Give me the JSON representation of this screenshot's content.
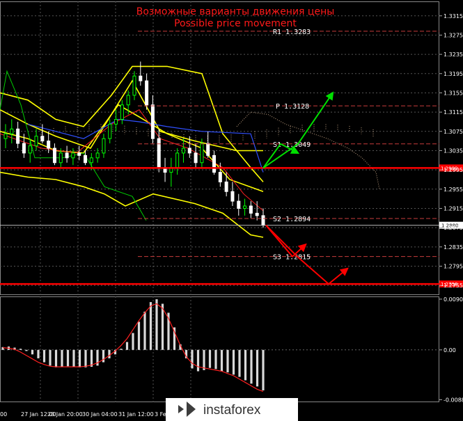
{
  "chart_data": {
    "type": "candlestick",
    "title": "Возможные варианты движения цены",
    "subtitle": "Possible price movement",
    "price_axis": {
      "ticks": [
        1.3315,
        1.3275,
        1.3235,
        1.3195,
        1.3155,
        1.3115,
        1.3075,
        1.3035,
        1.2995,
        1.2955,
        1.2915,
        1.2875,
        1.2835,
        1.2795,
        1.2755
      ],
      "labels": [
        "1.3315",
        "1.3275",
        "1.3235",
        "1.3195",
        "1.3155",
        "1.3115",
        "1.3075",
        "1.3035",
        "1.2995",
        "1.2955",
        "1.2915",
        "1.2875",
        "1.2835",
        "1.2795",
        "1.2755"
      ],
      "range": [
        1.2735,
        1.3345
      ]
    },
    "time_axis": {
      "labels": [
        "00",
        "27 Jan 12:00",
        "28 Jan 20:00",
        "30 Jan 04:00",
        "31 Jan 12:00",
        "3 Feb"
      ]
    },
    "levels": [
      {
        "name": "R1",
        "text": "R1  1.3283",
        "value": 1.3283,
        "color": "#c83c3c"
      },
      {
        "name": "P",
        "text": "P  1.3128",
        "value": 1.3128,
        "color": "#c83c3c"
      },
      {
        "name": "S1",
        "text": "S1  1.3049",
        "value": 1.3049,
        "color": "#c83c3c"
      },
      {
        "name": "S2",
        "text": "S2  1.2894",
        "value": 1.2894,
        "color": "#c83c3c"
      },
      {
        "name": "S3",
        "text": "S3  1.2815",
        "value": 1.2815,
        "color": "#c83c3c"
      }
    ],
    "support_resistance": [
      {
        "value": 1.2999,
        "label": "1.2999",
        "color": "#ff0000"
      },
      {
        "value": 1.2758,
        "label": "1.2758",
        "color": "#ff0000"
      }
    ],
    "current_price": {
      "value": 1.288,
      "label": "1.2880"
    },
    "candles": [
      [
        1.306,
        1.309,
        1.304,
        1.307
      ],
      [
        1.307,
        1.31,
        1.305,
        1.308
      ],
      [
        1.308,
        1.3095,
        1.304,
        1.305
      ],
      [
        1.305,
        1.307,
        1.302,
        1.303
      ],
      [
        1.303,
        1.306,
        1.301,
        1.3045
      ],
      [
        1.3045,
        1.308,
        1.3035,
        1.3065
      ],
      [
        1.3065,
        1.309,
        1.305,
        1.3055
      ],
      [
        1.3055,
        1.3075,
        1.303,
        1.304
      ],
      [
        1.304,
        1.305,
        1.3005,
        1.301
      ],
      [
        1.301,
        1.304,
        1.3,
        1.303
      ],
      [
        1.303,
        1.3045,
        1.301,
        1.302
      ],
      [
        1.302,
        1.304,
        1.3005,
        1.303
      ],
      [
        1.303,
        1.3045,
        1.3015,
        1.3025
      ],
      [
        1.3025,
        1.3035,
        1.3005,
        1.301
      ],
      [
        1.301,
        1.303,
        1.2995,
        1.302
      ],
      [
        1.302,
        1.304,
        1.301,
        1.303
      ],
      [
        1.303,
        1.307,
        1.302,
        1.306
      ],
      [
        1.306,
        1.31,
        1.305,
        1.309
      ],
      [
        1.309,
        1.312,
        1.3075,
        1.31
      ],
      [
        1.31,
        1.314,
        1.309,
        1.313
      ],
      [
        1.313,
        1.316,
        1.311,
        1.315
      ],
      [
        1.315,
        1.32,
        1.314,
        1.319
      ],
      [
        1.319,
        1.322,
        1.317,
        1.318
      ],
      [
        1.318,
        1.3195,
        1.312,
        1.313
      ],
      [
        1.313,
        1.315,
        1.305,
        1.306
      ],
      [
        1.306,
        1.308,
        1.299,
        1.3
      ],
      [
        1.3,
        1.302,
        1.297,
        1.299
      ],
      [
        1.299,
        1.302,
        1.296,
        1.3
      ],
      [
        1.3,
        1.304,
        1.2985,
        1.303
      ],
      [
        1.303,
        1.306,
        1.301,
        1.304
      ],
      [
        1.304,
        1.3065,
        1.302,
        1.303
      ],
      [
        1.303,
        1.305,
        1.3,
        1.301
      ],
      [
        1.301,
        1.306,
        1.3,
        1.305
      ],
      [
        1.305,
        1.3075,
        1.302,
        1.3025
      ],
      [
        1.3025,
        1.3035,
        1.2985,
        1.299
      ],
      [
        1.299,
        1.301,
        1.296,
        1.297
      ],
      [
        1.297,
        1.299,
        1.294,
        1.295
      ],
      [
        1.295,
        1.297,
        1.292,
        1.293
      ],
      [
        1.293,
        1.2945,
        1.29,
        1.2915
      ],
      [
        1.2915,
        1.2935,
        1.29,
        1.292
      ],
      [
        1.292,
        1.293,
        1.2895,
        1.2905
      ],
      [
        1.2905,
        1.293,
        1.289,
        1.29
      ],
      [
        1.29,
        1.2915,
        1.2875,
        1.288
      ]
    ],
    "projections": [
      {
        "color": "#00e000",
        "points": [
          [
            1.2999,
            0
          ],
          [
            1.3049,
            1
          ],
          [
            1.3155,
            2
          ]
        ]
      },
      {
        "color": "#00e000",
        "points": [
          [
            1.2999,
            0
          ],
          [
            1.3049,
            0.5
          ],
          [
            1.303,
            1
          ]
        ]
      },
      {
        "color": "#ff0000",
        "points": [
          [
            1.288,
            0
          ],
          [
            1.2815,
            1
          ],
          [
            1.284,
            1.5
          ]
        ]
      },
      {
        "color": "#ff0000",
        "points": [
          [
            1.288,
            0
          ],
          [
            1.2815,
            1
          ],
          [
            1.2758,
            2
          ],
          [
            1.279,
            2.6
          ]
        ]
      }
    ],
    "oscillator": {
      "labels": [
        "0.00902",
        "0.00",
        "-0.00885"
      ],
      "ticks": [
        0.00902,
        0.0,
        -0.00885
      ],
      "range": [
        -0.0093,
        0.0095
      ],
      "histogram": [
        0.0005,
        0.0006,
        0.0004,
        0.0002,
        -0.0002,
        -0.0008,
        -0.0015,
        -0.0022,
        -0.0028,
        -0.0031,
        -0.003,
        -0.0029,
        -0.003,
        -0.0031,
        -0.0031,
        -0.003,
        -0.0028,
        -0.0022,
        -0.0015,
        -0.0008,
        0.0002,
        0.0014,
        0.003,
        0.005,
        0.0068,
        0.0085,
        0.009,
        0.0082,
        0.0066,
        0.004,
        0.001,
        -0.0015,
        -0.0033,
        -0.0038,
        -0.0036,
        -0.0032,
        -0.0034,
        -0.0038,
        -0.004,
        -0.0044,
        -0.0048,
        -0.0054,
        -0.006,
        -0.0065,
        -0.0072
      ],
      "signal": [
        0.0004,
        0.0003,
        0.0001,
        -0.0004,
        -0.001,
        -0.0016,
        -0.0022,
        -0.0026,
        -0.0029,
        -0.003,
        -0.003,
        -0.003,
        -0.003,
        -0.003,
        -0.0029,
        -0.0027,
        -0.0023,
        -0.0017,
        -0.001,
        -0.0002,
        0.0008,
        0.002,
        0.0036,
        0.0052,
        0.0066,
        0.0078,
        0.0082,
        0.0074,
        0.0056,
        0.0032,
        0.0008,
        -0.0012,
        -0.0024,
        -0.003,
        -0.0032,
        -0.0034,
        -0.0036,
        -0.0038,
        -0.0042,
        -0.0046,
        -0.0052,
        -0.0058,
        -0.0064,
        -0.007,
        -0.0074
      ]
    },
    "grid": true
  },
  "watermark": {
    "text": "instaforex"
  },
  "colors": {
    "bull": "#00ff00",
    "bear": "#ffffff",
    "bands": "#ffff00",
    "accent": "#ff0000",
    "ma_red": "#ff2020",
    "ma_blue": "#3050ff",
    "ma_green": "#00cc00",
    "cloud": "#c0a080"
  }
}
